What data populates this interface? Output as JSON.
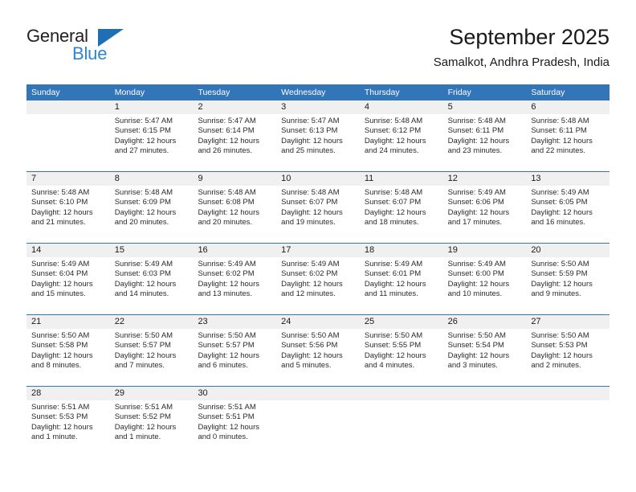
{
  "brand": {
    "name_top": "General",
    "name_bottom": "Blue",
    "accent_color": "#2e86d0",
    "triangle_color": "#1f6fb5"
  },
  "header": {
    "title": "September 2025",
    "subtitle": "Samalkot, Andhra Pradesh, India"
  },
  "theme": {
    "header_blue": "#3275b8",
    "date_band_gray": "#f0f0f0",
    "text_color": "#1a1a1a"
  },
  "weekdays": [
    "Sunday",
    "Monday",
    "Tuesday",
    "Wednesday",
    "Thursday",
    "Friday",
    "Saturday"
  ],
  "weeks": [
    [
      {
        "day": "",
        "lines": []
      },
      {
        "day": "1",
        "lines": [
          "Sunrise: 5:47 AM",
          "Sunset: 6:15 PM",
          "Daylight: 12 hours",
          "and 27 minutes."
        ]
      },
      {
        "day": "2",
        "lines": [
          "Sunrise: 5:47 AM",
          "Sunset: 6:14 PM",
          "Daylight: 12 hours",
          "and 26 minutes."
        ]
      },
      {
        "day": "3",
        "lines": [
          "Sunrise: 5:47 AM",
          "Sunset: 6:13 PM",
          "Daylight: 12 hours",
          "and 25 minutes."
        ]
      },
      {
        "day": "4",
        "lines": [
          "Sunrise: 5:48 AM",
          "Sunset: 6:12 PM",
          "Daylight: 12 hours",
          "and 24 minutes."
        ]
      },
      {
        "day": "5",
        "lines": [
          "Sunrise: 5:48 AM",
          "Sunset: 6:11 PM",
          "Daylight: 12 hours",
          "and 23 minutes."
        ]
      },
      {
        "day": "6",
        "lines": [
          "Sunrise: 5:48 AM",
          "Sunset: 6:11 PM",
          "Daylight: 12 hours",
          "and 22 minutes."
        ]
      }
    ],
    [
      {
        "day": "7",
        "lines": [
          "Sunrise: 5:48 AM",
          "Sunset: 6:10 PM",
          "Daylight: 12 hours",
          "and 21 minutes."
        ]
      },
      {
        "day": "8",
        "lines": [
          "Sunrise: 5:48 AM",
          "Sunset: 6:09 PM",
          "Daylight: 12 hours",
          "and 20 minutes."
        ]
      },
      {
        "day": "9",
        "lines": [
          "Sunrise: 5:48 AM",
          "Sunset: 6:08 PM",
          "Daylight: 12 hours",
          "and 20 minutes."
        ]
      },
      {
        "day": "10",
        "lines": [
          "Sunrise: 5:48 AM",
          "Sunset: 6:07 PM",
          "Daylight: 12 hours",
          "and 19 minutes."
        ]
      },
      {
        "day": "11",
        "lines": [
          "Sunrise: 5:48 AM",
          "Sunset: 6:07 PM",
          "Daylight: 12 hours",
          "and 18 minutes."
        ]
      },
      {
        "day": "12",
        "lines": [
          "Sunrise: 5:49 AM",
          "Sunset: 6:06 PM",
          "Daylight: 12 hours",
          "and 17 minutes."
        ]
      },
      {
        "day": "13",
        "lines": [
          "Sunrise: 5:49 AM",
          "Sunset: 6:05 PM",
          "Daylight: 12 hours",
          "and 16 minutes."
        ]
      }
    ],
    [
      {
        "day": "14",
        "lines": [
          "Sunrise: 5:49 AM",
          "Sunset: 6:04 PM",
          "Daylight: 12 hours",
          "and 15 minutes."
        ]
      },
      {
        "day": "15",
        "lines": [
          "Sunrise: 5:49 AM",
          "Sunset: 6:03 PM",
          "Daylight: 12 hours",
          "and 14 minutes."
        ]
      },
      {
        "day": "16",
        "lines": [
          "Sunrise: 5:49 AM",
          "Sunset: 6:02 PM",
          "Daylight: 12 hours",
          "and 13 minutes."
        ]
      },
      {
        "day": "17",
        "lines": [
          "Sunrise: 5:49 AM",
          "Sunset: 6:02 PM",
          "Daylight: 12 hours",
          "and 12 minutes."
        ]
      },
      {
        "day": "18",
        "lines": [
          "Sunrise: 5:49 AM",
          "Sunset: 6:01 PM",
          "Daylight: 12 hours",
          "and 11 minutes."
        ]
      },
      {
        "day": "19",
        "lines": [
          "Sunrise: 5:49 AM",
          "Sunset: 6:00 PM",
          "Daylight: 12 hours",
          "and 10 minutes."
        ]
      },
      {
        "day": "20",
        "lines": [
          "Sunrise: 5:50 AM",
          "Sunset: 5:59 PM",
          "Daylight: 12 hours",
          "and 9 minutes."
        ]
      }
    ],
    [
      {
        "day": "21",
        "lines": [
          "Sunrise: 5:50 AM",
          "Sunset: 5:58 PM",
          "Daylight: 12 hours",
          "and 8 minutes."
        ]
      },
      {
        "day": "22",
        "lines": [
          "Sunrise: 5:50 AM",
          "Sunset: 5:57 PM",
          "Daylight: 12 hours",
          "and 7 minutes."
        ]
      },
      {
        "day": "23",
        "lines": [
          "Sunrise: 5:50 AM",
          "Sunset: 5:57 PM",
          "Daylight: 12 hours",
          "and 6 minutes."
        ]
      },
      {
        "day": "24",
        "lines": [
          "Sunrise: 5:50 AM",
          "Sunset: 5:56 PM",
          "Daylight: 12 hours",
          "and 5 minutes."
        ]
      },
      {
        "day": "25",
        "lines": [
          "Sunrise: 5:50 AM",
          "Sunset: 5:55 PM",
          "Daylight: 12 hours",
          "and 4 minutes."
        ]
      },
      {
        "day": "26",
        "lines": [
          "Sunrise: 5:50 AM",
          "Sunset: 5:54 PM",
          "Daylight: 12 hours",
          "and 3 minutes."
        ]
      },
      {
        "day": "27",
        "lines": [
          "Sunrise: 5:50 AM",
          "Sunset: 5:53 PM",
          "Daylight: 12 hours",
          "and 2 minutes."
        ]
      }
    ],
    [
      {
        "day": "28",
        "lines": [
          "Sunrise: 5:51 AM",
          "Sunset: 5:53 PM",
          "Daylight: 12 hours",
          "and 1 minute."
        ]
      },
      {
        "day": "29",
        "lines": [
          "Sunrise: 5:51 AM",
          "Sunset: 5:52 PM",
          "Daylight: 12 hours",
          "and 1 minute."
        ]
      },
      {
        "day": "30",
        "lines": [
          "Sunrise: 5:51 AM",
          "Sunset: 5:51 PM",
          "Daylight: 12 hours",
          "and 0 minutes."
        ]
      },
      {
        "day": "",
        "lines": []
      },
      {
        "day": "",
        "lines": []
      },
      {
        "day": "",
        "lines": []
      },
      {
        "day": "",
        "lines": []
      }
    ]
  ]
}
